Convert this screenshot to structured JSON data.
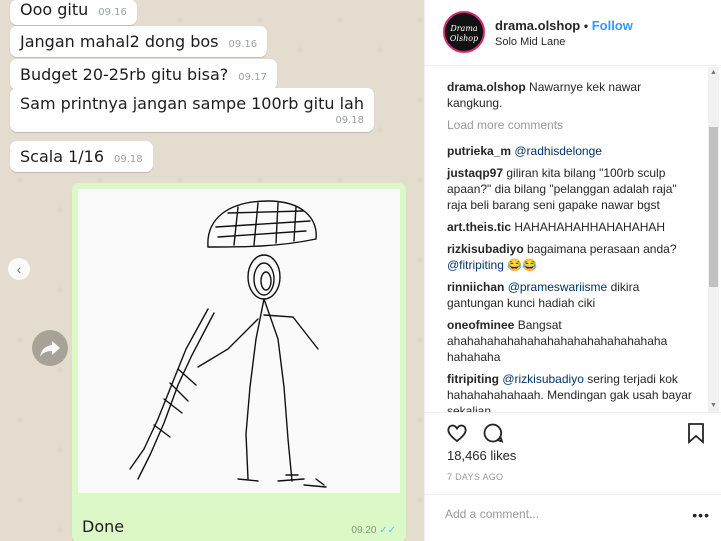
{
  "chat": {
    "messages": [
      {
        "text": "Ooo gitu",
        "time": "09.16"
      },
      {
        "text": "Jangan mahal2 dong bos",
        "time": "09.16"
      },
      {
        "text": "Budget 20-25rb gitu bisa?",
        "time": "09.17"
      },
      {
        "text": "Sam printnya jangan sampe 100rb gitu lah",
        "time": "09.18"
      },
      {
        "text": "Scala 1/16",
        "time": "09.18"
      }
    ],
    "image_message": {
      "caption": "Done",
      "time": "09.20",
      "ticks": "✓✓"
    }
  },
  "carousel": {
    "prev_glyph": "‹"
  },
  "post": {
    "username": "drama.olshop",
    "separator": "•",
    "follow_label": "Follow",
    "location": "Solo Mid Lane",
    "avatar_text": "Drama Olshop",
    "caption": {
      "user": "drama.olshop",
      "text": "Nawarnye kek nawar kangkung."
    },
    "load_more": "Load more comments",
    "comments": [
      {
        "user": "putrieka_m",
        "mention": "@radhisdelonge",
        "text": ""
      },
      {
        "user": "justaqp97",
        "mention": "",
        "text": "giliran kita bilang \"100rb sculp apaan?\" dia bilang \"pelanggan adalah raja\" raja beli barang seni gapake nawar bgst"
      },
      {
        "user": "art.theis.tic",
        "mention": "",
        "text": "HAHAHAHAHHAHAHAHAH"
      },
      {
        "user": "rizkisubadiyo",
        "mention": "",
        "text": "bagaimana perasaan anda?",
        "mention2": "@fitripiting",
        "text2": "😂😂"
      },
      {
        "user": "rinniichan",
        "mention": "@prameswariisme",
        "text": "dikira gantungan kunci hadiah ciki"
      },
      {
        "user": "oneofminee",
        "mention": "",
        "text": "Bangsat ahahahahahahahahahahahahahahahaha hahahaha"
      },
      {
        "user": "fitripiting",
        "mention": "@rizkisubadiyo",
        "text": "sering terjadi kok hahahahahahaah. Mendingan gak usah bayar sekalian"
      }
    ],
    "likes": "18,466 likes",
    "time_ago": "7 DAYS AGO",
    "add_comment_placeholder": "Add a comment...",
    "more_glyph": "•••",
    "scroll_up_glyph": "▲",
    "scroll_down_glyph": "▼",
    "icons": [
      "heart-icon",
      "comment-icon",
      "bookmark-icon",
      "share-icon"
    ]
  }
}
